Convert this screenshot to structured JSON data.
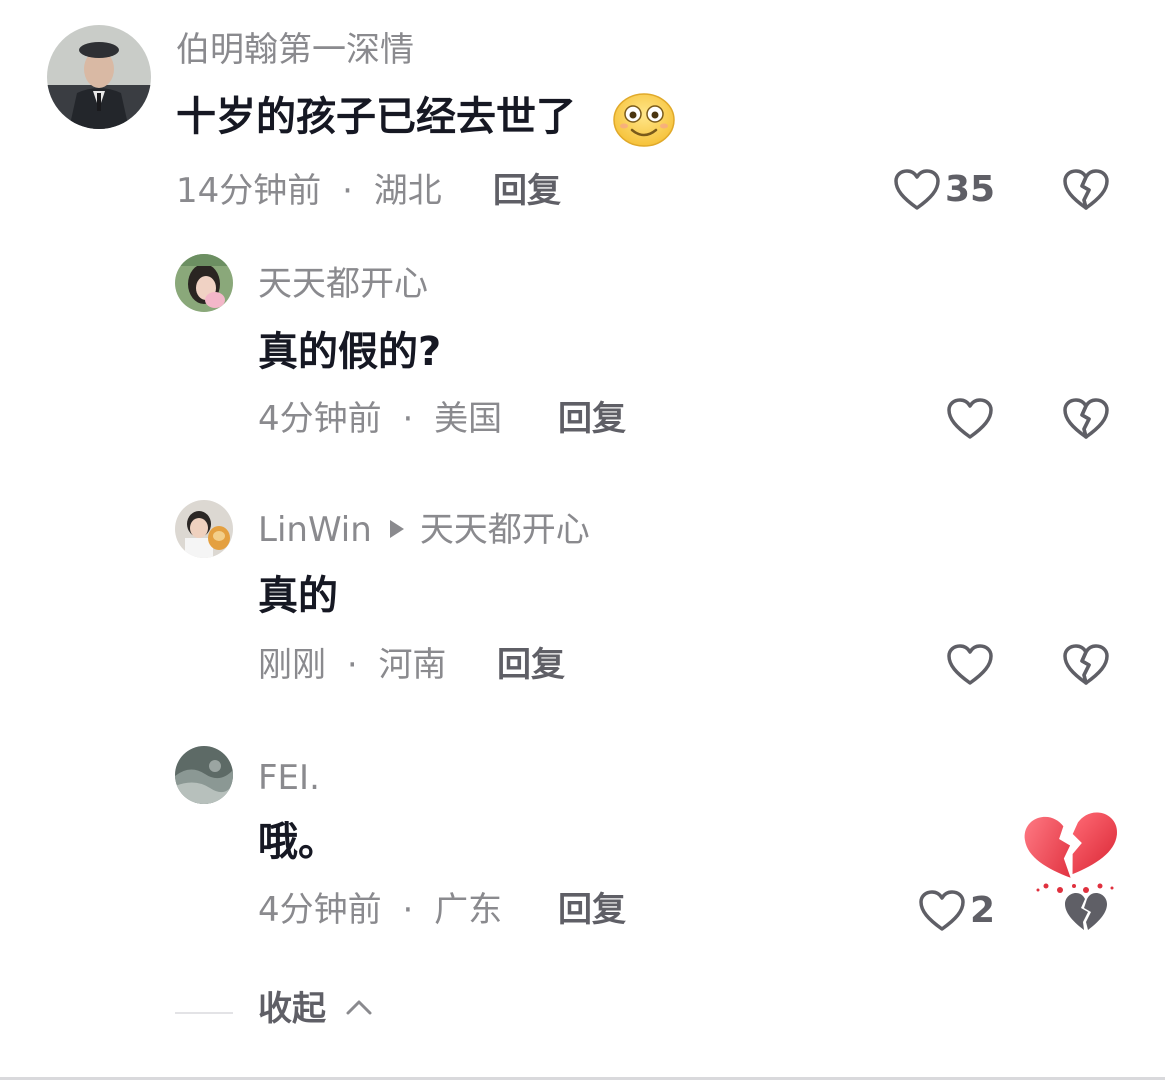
{
  "comments": [
    {
      "username": "伯明翰第一深情",
      "content": "十岁的孩子已经去世了",
      "emoji": "smile-emoji",
      "time": "14分钟前",
      "location": "湖北",
      "reply_label": "回复",
      "likes": "35"
    },
    {
      "username": "天天都开心",
      "content": "真的假的?",
      "time": "4分钟前",
      "location": "美国",
      "reply_label": "回复",
      "likes": ""
    },
    {
      "username": "LinWin",
      "reply_to": "天天都开心",
      "content": "真的",
      "time": "刚刚",
      "location": "河南",
      "reply_label": "回复",
      "likes": ""
    },
    {
      "username": "FEI.",
      "content": "哦。",
      "time": "4分钟前",
      "location": "广东",
      "reply_label": "回复",
      "likes": "2"
    }
  ],
  "collapse": {
    "label": "收起"
  },
  "separator": "·",
  "colors": {
    "text_primary": "#161823",
    "text_secondary": "#8a8a8e",
    "action": "#5f5f66",
    "broken_heart_red": "#f0434f"
  },
  "icons": {
    "like": "heart-outline-icon",
    "dislike": "broken-heart-outline-icon",
    "dislike_active": "broken-heart-filled-icon",
    "animation": "red-broken-heart-icon"
  }
}
